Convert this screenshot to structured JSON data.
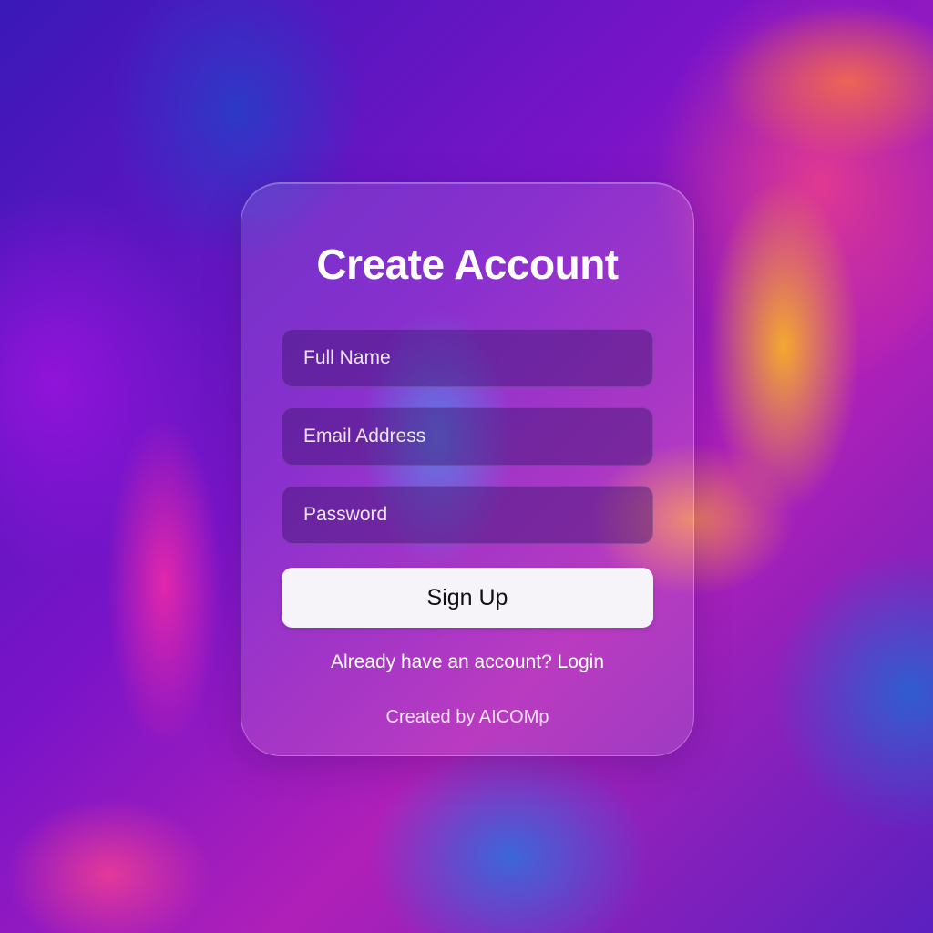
{
  "form": {
    "title": "Create Account",
    "fields": {
      "full_name_placeholder": "Full Name",
      "email_placeholder": "Email Address",
      "password_placeholder": "Password"
    },
    "submit_label": "Sign Up",
    "login_prompt": "Already have an account?",
    "login_link": "Login",
    "credit": "Created by AICOMp"
  },
  "colors": {
    "card_background": "rgba(255,255,255,0.12)",
    "field_background": "rgba(60,20,110,0.45)",
    "button_background": "#f6f3f9",
    "text_primary": "#ffffff"
  }
}
